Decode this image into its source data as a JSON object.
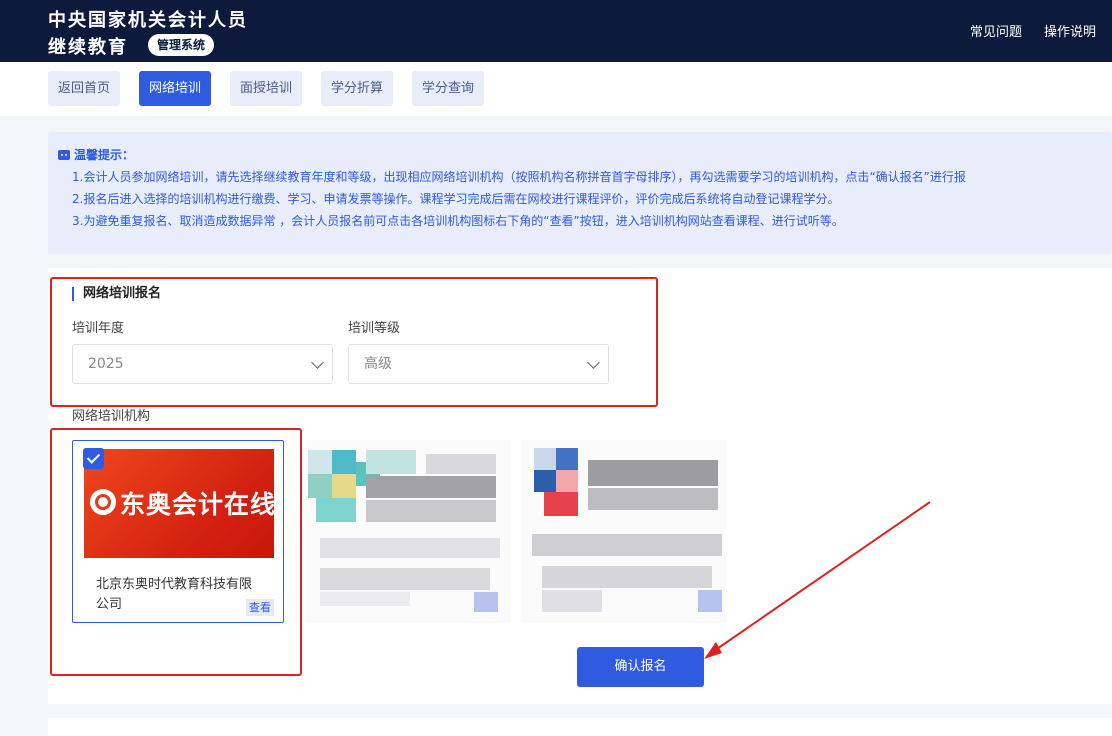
{
  "header": {
    "title_line1": "中央国家机关会计人员",
    "title_line2": "继续教育",
    "badge": "管理系统",
    "links": [
      "常见问题",
      "操作说明"
    ]
  },
  "nav": {
    "items": [
      "返回首页",
      "网络培训",
      "面授培训",
      "学分折算",
      "学分查询"
    ],
    "active_index": 1
  },
  "notice": {
    "title": "温馨提示：",
    "lines": [
      "1.会计人员参加网络培训，请先选择继续教育年度和等级，出现相应网络培训机构（按照机构名称拼音首字母排序），再勾选需要学习的培训机构，点击“确认报名”进行报",
      "2.报名后进入选择的培训机构进行缴费、学习、申请发票等操作。课程学习完成后需在网校进行课程评价，评价完成后系统将自动登记课程学分。",
      "3.为避免重复报名、取消造成数据异常 ，会计人员报名前可点击各培训机构图标右下角的“查看”按钮，进入培训机构网站查看课程、进行试听等。"
    ]
  },
  "form": {
    "section_title": "网络培训报名",
    "year_label": "培训年度",
    "year_value": "2025",
    "level_label": "培训等级",
    "level_value": "高级",
    "institutions_label": "网络培训机构"
  },
  "institutions": [
    {
      "logo_text": "东奥会计在线",
      "name": "北京东奥时代教育科技有限公司",
      "view_label": "查看",
      "selected": true
    }
  ],
  "confirm_label": "确认报名",
  "colors": {
    "header_bg": "#0e1a3c",
    "primary": "#2e5bdf",
    "annotation_red": "#e02020"
  }
}
